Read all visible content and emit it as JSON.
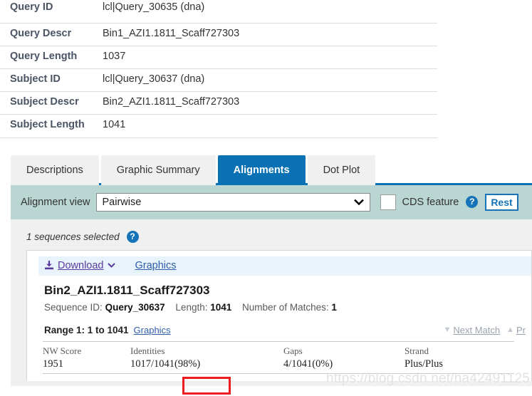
{
  "summary": {
    "rows": [
      {
        "label": "Query ID",
        "value": "lcl|Query_30635 (dna)"
      },
      {
        "label": "Query Descr",
        "value": "Bin1_AZI1.1811_Scaff727303"
      },
      {
        "label": "Query Length",
        "value": "1037"
      },
      {
        "label": "Subject ID",
        "value": "lcl|Query_30637 (dna)"
      },
      {
        "label": "Subject Descr",
        "value": "Bin2_AZI1.1811_Scaff727303"
      },
      {
        "label": "Subject Length",
        "value": "1041"
      }
    ]
  },
  "tabs": [
    {
      "label": "Descriptions",
      "active": false
    },
    {
      "label": "Graphic Summary",
      "active": false
    },
    {
      "label": "Alignments",
      "active": true
    },
    {
      "label": "Dot Plot",
      "active": false
    }
  ],
  "controls": {
    "alignment_view_label": "Alignment view",
    "alignment_view_value": "Pairwise",
    "alignment_view_caret": "⌄",
    "cds_feature_label": "CDS feature",
    "cds_feature_checked": false,
    "help_icon_glyph": "?",
    "restore_button_label": "Rest",
    "accent_color": "#0a71b5"
  },
  "selection": {
    "text": "1 sequences selected",
    "help_icon_glyph": "?"
  },
  "download_bar": {
    "download_label": "Download",
    "download_caret": "⌄",
    "graphics_label": "Graphics"
  },
  "hit": {
    "title": "Bin2_AZI1.1811_Scaff727303",
    "sequence_id_label": "Sequence ID:",
    "sequence_id_value": "Query_30637",
    "length_label": "Length:",
    "length_value": "1041",
    "matches_label": "Number of Matches:",
    "matches_value": "1",
    "range_text": "Range 1: 1 to 1041",
    "range_graphics_label": "Graphics",
    "next_match_label": "Next Match",
    "next_match_tri": "▼",
    "prev_match_label": "Pr",
    "prev_match_tri": "▲"
  },
  "stats": {
    "headers": [
      "NW Score",
      "Identities",
      "Gaps",
      "Strand"
    ],
    "values": [
      "1951",
      "1017/1041(98%)",
      "4/1041(0%)",
      "Plus/Plus"
    ]
  },
  "annotation": {
    "highlight_color": "#ee1c20",
    "highlight_target": "(98%)"
  },
  "watermark": {
    "text": "https://blog.csdn.net/ha42491125"
  }
}
